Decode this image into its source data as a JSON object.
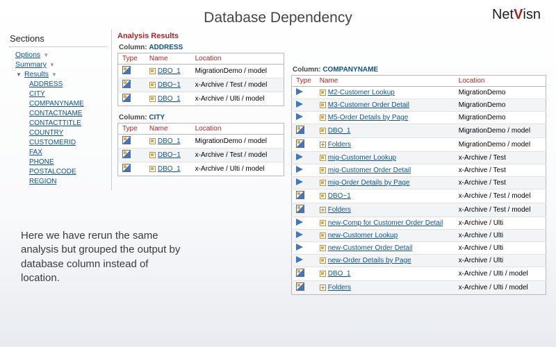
{
  "page_title": "Database Dependency",
  "logo": {
    "part1": "Net",
    "part2": "V",
    "part3": "isn"
  },
  "sidebar": {
    "header": "Sections",
    "items": [
      {
        "label": "Options",
        "expanded": false
      },
      {
        "label": "Summary",
        "expanded": false
      },
      {
        "label": "Results",
        "expanded": true
      }
    ],
    "results_children": [
      "ADDRESS",
      "CITY",
      "COMPANYNAME",
      "CONTACTNAME",
      "CONTACTTITLE",
      "COUNTRY",
      "CUSTOMERID",
      "FAX",
      "PHONE",
      "POSTALCODE",
      "REGION"
    ]
  },
  "analysis_header": "Analysis Results",
  "column_label_prefix": "Column:",
  "table_headers": {
    "type": "Type",
    "name": "Name",
    "location": "Location"
  },
  "address": {
    "column": "ADDRESS",
    "rows": [
      {
        "type": "report",
        "icon": "sq",
        "name": "DBO_1",
        "location": "MigrationDemo / model"
      },
      {
        "type": "report",
        "icon": "sq",
        "name": "DBO~1",
        "location": "x-Archive / Test / model"
      },
      {
        "type": "report",
        "icon": "sq",
        "name": "DBO_1",
        "location": "x-Archive / Ulti / model"
      }
    ]
  },
  "city": {
    "column": "CITY",
    "rows": [
      {
        "type": "report",
        "icon": "sq",
        "name": "DBO_1",
        "location": "MigrationDemo / model"
      },
      {
        "type": "report",
        "icon": "sq",
        "name": "DBO~1",
        "location": "x-Archive / Test / model"
      },
      {
        "type": "report",
        "icon": "sq",
        "name": "DBO_1",
        "location": "x-Archive / Ulti / model"
      }
    ]
  },
  "company": {
    "column": "COMPANYNAME",
    "rows": [
      {
        "type": "tri",
        "icon": "sq",
        "name": "M2-Customer Lookup",
        "location": "MigrationDemo"
      },
      {
        "type": "tri",
        "icon": "sq",
        "name": "M3-Customer Order Detail",
        "location": "MigrationDemo"
      },
      {
        "type": "tri",
        "icon": "sq",
        "name": "M5-Order Details by Page",
        "location": "MigrationDemo"
      },
      {
        "type": "report",
        "icon": "sq",
        "name": "DBO_1",
        "location": "MigrationDemo / model"
      },
      {
        "type": "report",
        "icon": "plus",
        "name": "Folders",
        "location": "MigrationDemo / model"
      },
      {
        "type": "tri",
        "icon": "sq",
        "name": "mig-Customer Lookup",
        "location": "x-Archive / Test"
      },
      {
        "type": "tri",
        "icon": "sq",
        "name": "mig-Customer Order Detail",
        "location": "x-Archive / Test"
      },
      {
        "type": "tri",
        "icon": "sq",
        "name": "mig-Order Details by Page",
        "location": "x-Archive / Test"
      },
      {
        "type": "report",
        "icon": "sq",
        "name": "DBO~1",
        "location": "x-Archive / Test / model"
      },
      {
        "type": "report",
        "icon": "plus",
        "name": "Folders",
        "location": "x-Archive / Test / model"
      },
      {
        "type": "tri",
        "icon": "sq",
        "name": "new-Comp for Customer Order Detail",
        "location": "x-Archive / Ulti"
      },
      {
        "type": "tri",
        "icon": "sq",
        "name": "new-Customer Lookup",
        "location": "x-Archive / Ulti"
      },
      {
        "type": "tri",
        "icon": "sq",
        "name": "new-Customer Order Detail",
        "location": "x-Archive / Ulti"
      },
      {
        "type": "tri",
        "icon": "sq",
        "name": "new-Order Details by Page",
        "location": "x-Archive / Ulti"
      },
      {
        "type": "report",
        "icon": "sq",
        "name": "DBO_1",
        "location": "x-Archive / Ulti / model"
      },
      {
        "type": "report",
        "icon": "plus",
        "name": "Folders",
        "location": "x-Archive / Ulti / model"
      }
    ]
  },
  "caption": "Here we have rerun the same analysis but grouped the output by database column instead of location."
}
